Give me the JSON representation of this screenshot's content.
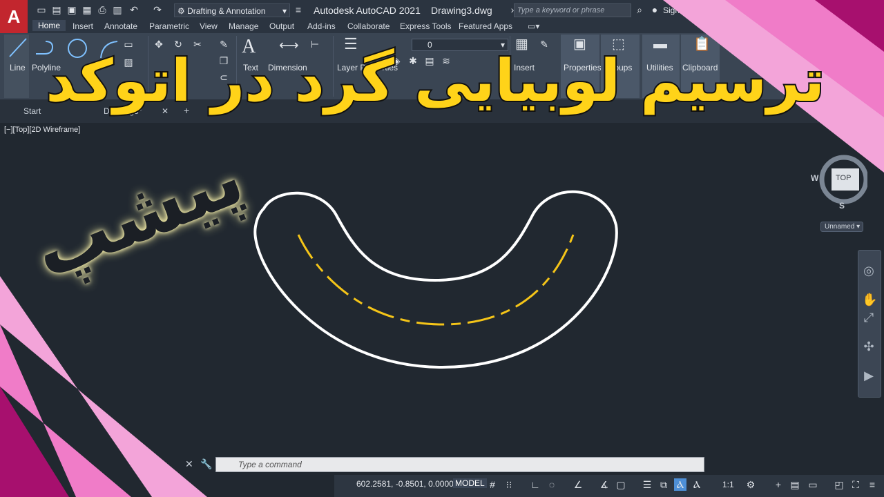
{
  "app": {
    "logo": "A",
    "title": "Autodesk AutoCAD 2021",
    "document": "Drawing3.dwg",
    "workspace": "Drafting & Annotation",
    "search_placeholder": "Type a keyword or phrase",
    "signin": "Sign In"
  },
  "ribbon_tabs": [
    "Home",
    "Insert",
    "Annotate",
    "Parametric",
    "View",
    "Manage",
    "Output",
    "Add-ins",
    "Collaborate",
    "Express Tools",
    "Featured Apps"
  ],
  "ribbon_buttons": {
    "line": "Line",
    "polyline": "Polyline",
    "circle": "Circle",
    "text": "Text",
    "dimension": "Dimension",
    "layer_properties": "Layer Properties",
    "insert": "Insert",
    "properties": "Properties",
    "groups": "Groups",
    "utilities": "Utilities",
    "clipboard": "Clipboard",
    "layer_current": "0"
  },
  "file_tabs": {
    "start": "Start",
    "drawing": "Drawing3*"
  },
  "viewport_label": "[−][Top][2D Wireframe]",
  "viewcube": {
    "west": "W",
    "south": "S",
    "top": "TOP",
    "ucs": "Unnamed"
  },
  "command_placeholder": "Type a command",
  "status": {
    "coordinates": "602.2581, -0.8501, 0.0000",
    "model": "MODEL",
    "scale": "1:1"
  },
  "overlay": {
    "headline": "ترسیم لوبیایی گرد در اتوکد",
    "side": "پیشپ"
  },
  "colors": {
    "canvas": "#212830",
    "outline": "#ffffff",
    "centerline": "#f5c518",
    "headline": "#ffd319",
    "banner_pink": "#f07cc8",
    "autocad_red": "#c2262e"
  }
}
